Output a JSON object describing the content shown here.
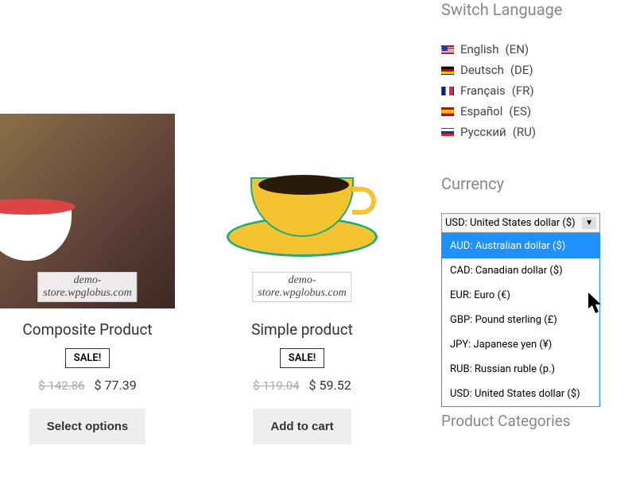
{
  "watermark": "demo-store.wpglobus.com",
  "products": [
    {
      "title": "Composite Product",
      "sale_badge": "SALE!",
      "old_price": "$ 142.86",
      "new_price": "$ 77.39",
      "action": "Select options"
    },
    {
      "title": "Simple product",
      "sale_badge": "SALE!",
      "old_price": "$ 119.04",
      "new_price": "$ 59.52",
      "action": "Add to cart"
    }
  ],
  "sidebar": {
    "switch_language_title": "Switch Language",
    "languages": [
      {
        "label": "English",
        "code": "(EN)",
        "flag": "us"
      },
      {
        "label": "Deutsch",
        "code": "(DE)",
        "flag": "de"
      },
      {
        "label": "Français",
        "code": "(FR)",
        "flag": "fr"
      },
      {
        "label": "Español",
        "code": "(ES)",
        "flag": "es"
      },
      {
        "label": "Русский",
        "code": "(RU)",
        "flag": "ru"
      }
    ],
    "currency_title": "Currency",
    "currency_selected": "USD: United States dollar ($)",
    "currency_options": [
      {
        "label": "AUD: Australian dollar ($)",
        "highlighted": true
      },
      {
        "label": "CAD: Canadian dollar ($)"
      },
      {
        "label": "EUR: Euro (€)"
      },
      {
        "label": "GBP: Pound sterling (£)"
      },
      {
        "label": "JPY: Japanese yen (¥)"
      },
      {
        "label": "RUB: Russian ruble (р.)"
      },
      {
        "label": "USD: United States dollar ($)"
      }
    ],
    "categories_title": "Product Categories"
  }
}
